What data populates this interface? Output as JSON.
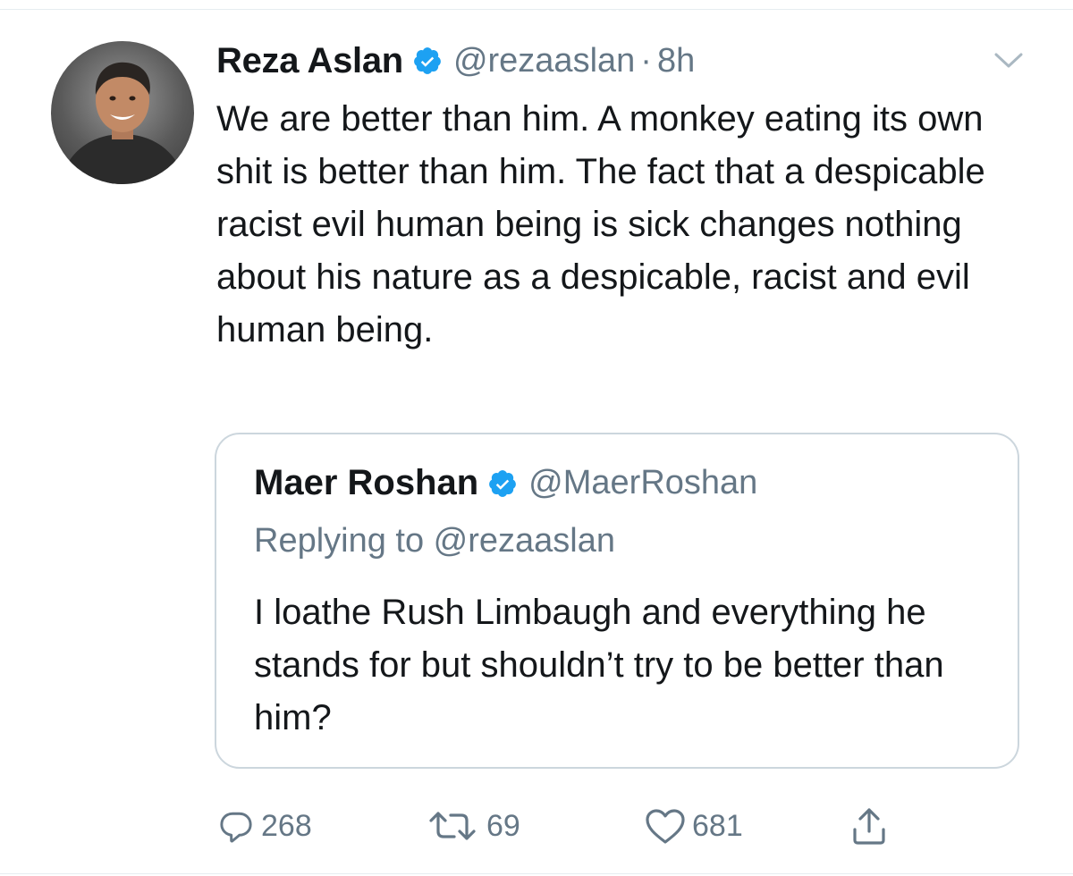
{
  "tweet": {
    "author_name": "Reza Aslan",
    "handle": "@rezaaslan",
    "separator": "·",
    "time": "8h",
    "verified": true,
    "text": "We are better than him. A monkey eating its own shit is better than him. The fact that a despicable racist evil human being is sick changes nothing about his nature as a despicable, racist and evil human being."
  },
  "quote": {
    "author_name": "Maer Roshan",
    "handle": "@MaerRoshan",
    "verified": true,
    "replying_to": "Replying to @rezaaslan",
    "text": "I loathe Rush Limbaugh and everything he stands for but shouldn’t try to be better than him?"
  },
  "actions": {
    "reply_count": "268",
    "retweet_count": "69",
    "like_count": "681"
  },
  "icons": {
    "verified": "verified-badge-icon",
    "menu": "chevron-down-icon",
    "reply": "reply-bubble-icon",
    "retweet": "retweet-icon",
    "like": "heart-icon",
    "share": "share-icon"
  },
  "colors": {
    "verified_blue": "#1da1f2",
    "secondary_text": "#657786",
    "primary_text": "#14171a",
    "border": "#ccd6dd"
  }
}
